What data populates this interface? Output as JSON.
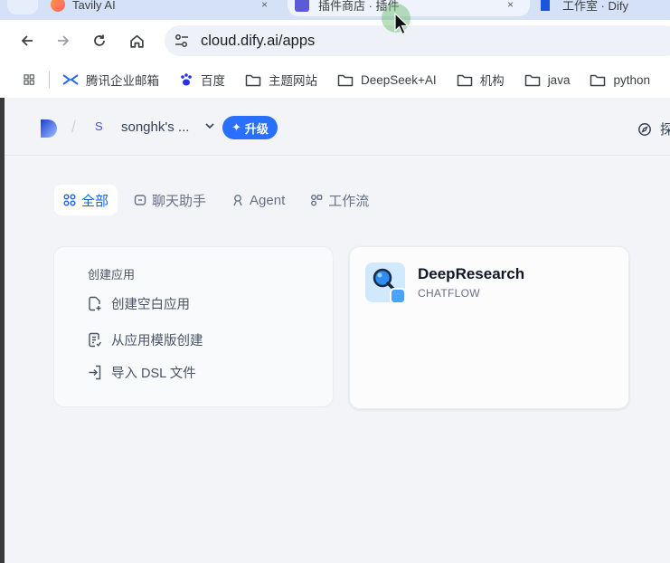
{
  "browser": {
    "tabs": [
      {
        "label": "Tavily AI",
        "close": "×"
      },
      {
        "label": "插件商店 · 插件",
        "close": "×"
      },
      {
        "label": "工作室 · Dify"
      }
    ],
    "url": "cloud.dify.ai/apps",
    "bookmarks": [
      {
        "label": "腾讯企业邮箱",
        "icon": "tencent-mail-icon"
      },
      {
        "label": "百度",
        "icon": "baidu-paw-icon"
      },
      {
        "label": "主题网站",
        "icon": "folder-icon"
      },
      {
        "label": "DeepSeek+AI",
        "icon": "folder-icon"
      },
      {
        "label": "机构",
        "icon": "folder-icon"
      },
      {
        "label": "java",
        "icon": "folder-icon"
      },
      {
        "label": "python",
        "icon": "folder-icon"
      }
    ]
  },
  "header": {
    "separator": "/",
    "workspace_initial": "S",
    "workspace_name": "songhk's ...",
    "upgrade_label": "升级",
    "upgrade_icon": "✦",
    "right_tool_label": "探"
  },
  "filters": {
    "tabs": [
      {
        "label": "全部",
        "icon": "grid-icon",
        "active": true
      },
      {
        "label": "聊天助手",
        "icon": "chat-icon",
        "active": false
      },
      {
        "label": "Agent",
        "icon": "agent-icon",
        "active": false
      },
      {
        "label": "工作流",
        "icon": "workflow-icon",
        "active": false
      }
    ]
  },
  "create_card": {
    "heading": "创建应用",
    "items": [
      {
        "label": "创建空白应用",
        "icon": "new-file-icon"
      },
      {
        "label": "从应用模版创建",
        "icon": "template-icon"
      },
      {
        "label": "导入 DSL 文件",
        "icon": "import-icon"
      }
    ]
  },
  "apps": [
    {
      "name": "DeepResearch",
      "type": "CHATFLOW",
      "icon": "magnifier-icon",
      "icon_bg": "#d1e9ff"
    }
  ],
  "colors": {
    "accent": "#155eef",
    "upgrade_bg": "#2970ff",
    "page_bg": "#f2f4f7"
  }
}
